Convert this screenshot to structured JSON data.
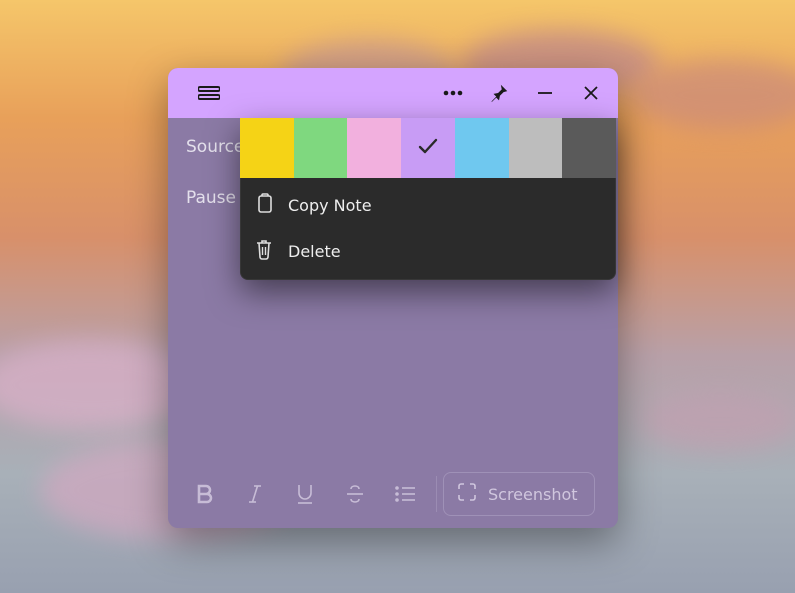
{
  "note": {
    "body": {
      "line1": "Sources checking",
      "line2": "Pause wednes"
    }
  },
  "toolbar": {
    "bold": "B",
    "italic": "I",
    "underline": "U",
    "strike": "S",
    "bullet": "•",
    "screenshot_label": "Screenshot"
  },
  "popup": {
    "colors": [
      {
        "name": "yellow",
        "hex": "#f5d316",
        "selected": false
      },
      {
        "name": "green",
        "hex": "#7fd87f",
        "selected": false
      },
      {
        "name": "pink",
        "hex": "#f2b0de",
        "selected": false
      },
      {
        "name": "purple",
        "hex": "#c89cf5",
        "selected": true
      },
      {
        "name": "blue",
        "hex": "#6fc8ef",
        "selected": false
      },
      {
        "name": "light-gray",
        "hex": "#bdbdbd",
        "selected": false
      },
      {
        "name": "dark-gray",
        "hex": "#5a5a5a",
        "selected": false
      }
    ],
    "copy_label": "Copy Note",
    "delete_label": "Delete"
  }
}
